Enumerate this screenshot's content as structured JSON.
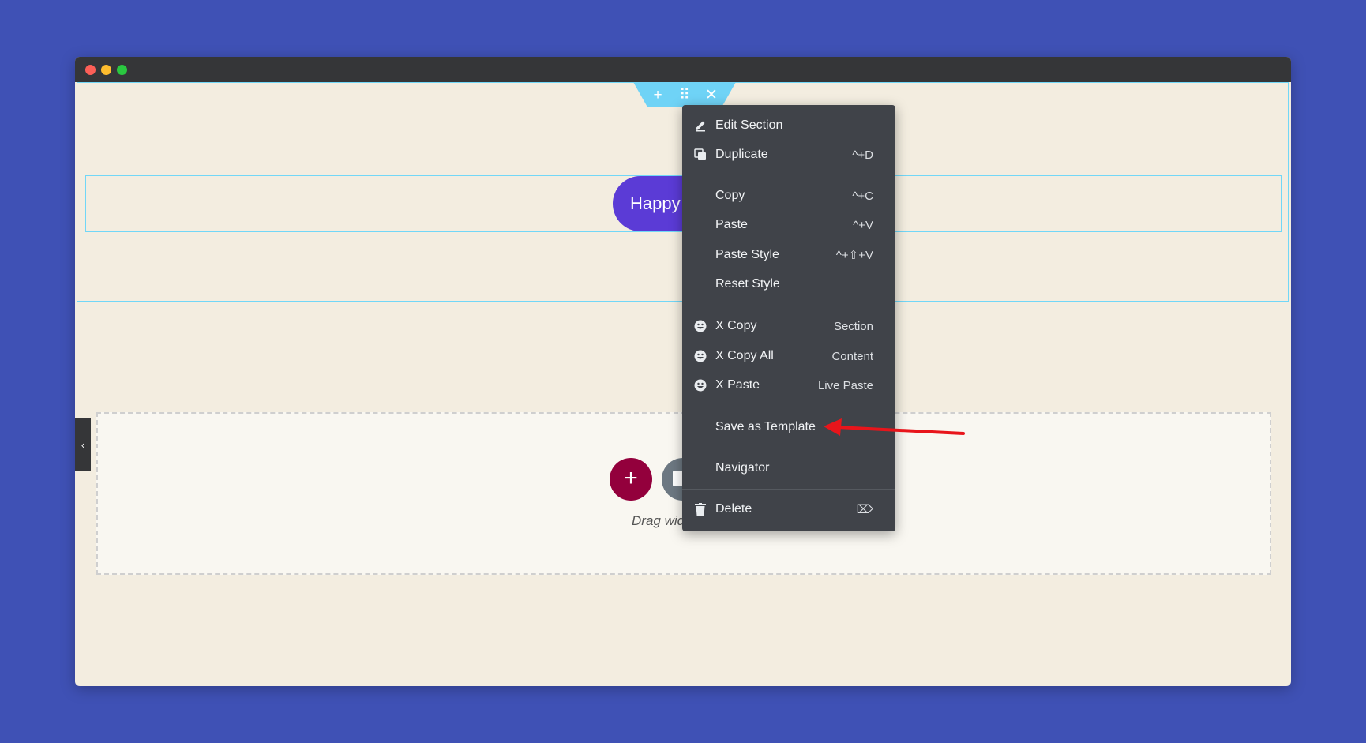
{
  "canvas": {
    "button_label": "Happy Addons",
    "drag_text": "Drag widget here"
  },
  "section_toolbar": {
    "add_icon": "plus-icon",
    "move_icon": "drag-dots-icon",
    "close_icon": "close-icon",
    "add_symbol": "+",
    "move_symbol": "⠿",
    "close_symbol": "✕"
  },
  "add_section": {
    "add_symbol": "+"
  },
  "side_toggle": {
    "symbol": "‹"
  },
  "context_menu": {
    "items": [
      {
        "label": "Edit Section",
        "shortcut": "",
        "icon": "pencil-icon"
      },
      {
        "label": "Duplicate",
        "shortcut": "^+D",
        "icon": "duplicate-icon"
      },
      {
        "label": "Copy",
        "shortcut": "^+C",
        "icon": ""
      },
      {
        "label": "Paste",
        "shortcut": "^+V",
        "icon": ""
      },
      {
        "label": "Paste Style",
        "shortcut": "^+⇧+V",
        "icon": ""
      },
      {
        "label": "Reset Style",
        "shortcut": "",
        "icon": ""
      },
      {
        "label": "X Copy",
        "shortcut": "Section",
        "icon": "happy-face-icon"
      },
      {
        "label": "X Copy All",
        "shortcut": "Content",
        "icon": "happy-face-icon"
      },
      {
        "label": "X Paste",
        "shortcut": "Live Paste",
        "icon": "happy-face-icon"
      },
      {
        "label": "Save as Template",
        "shortcut": "",
        "icon": ""
      },
      {
        "label": "Navigator",
        "shortcut": "",
        "icon": ""
      },
      {
        "label": "Delete",
        "shortcut": "⌦",
        "icon": "trash-icon"
      }
    ]
  },
  "colors": {
    "background": "#3f51b5",
    "titlebar": "#353638",
    "canvas": "#f3ede0",
    "section_outline": "#71d7f7",
    "menu_bg": "#404349",
    "happy_button": "#5b3bd6",
    "add_button": "#93003c",
    "annotation_arrow": "#e8151b"
  }
}
